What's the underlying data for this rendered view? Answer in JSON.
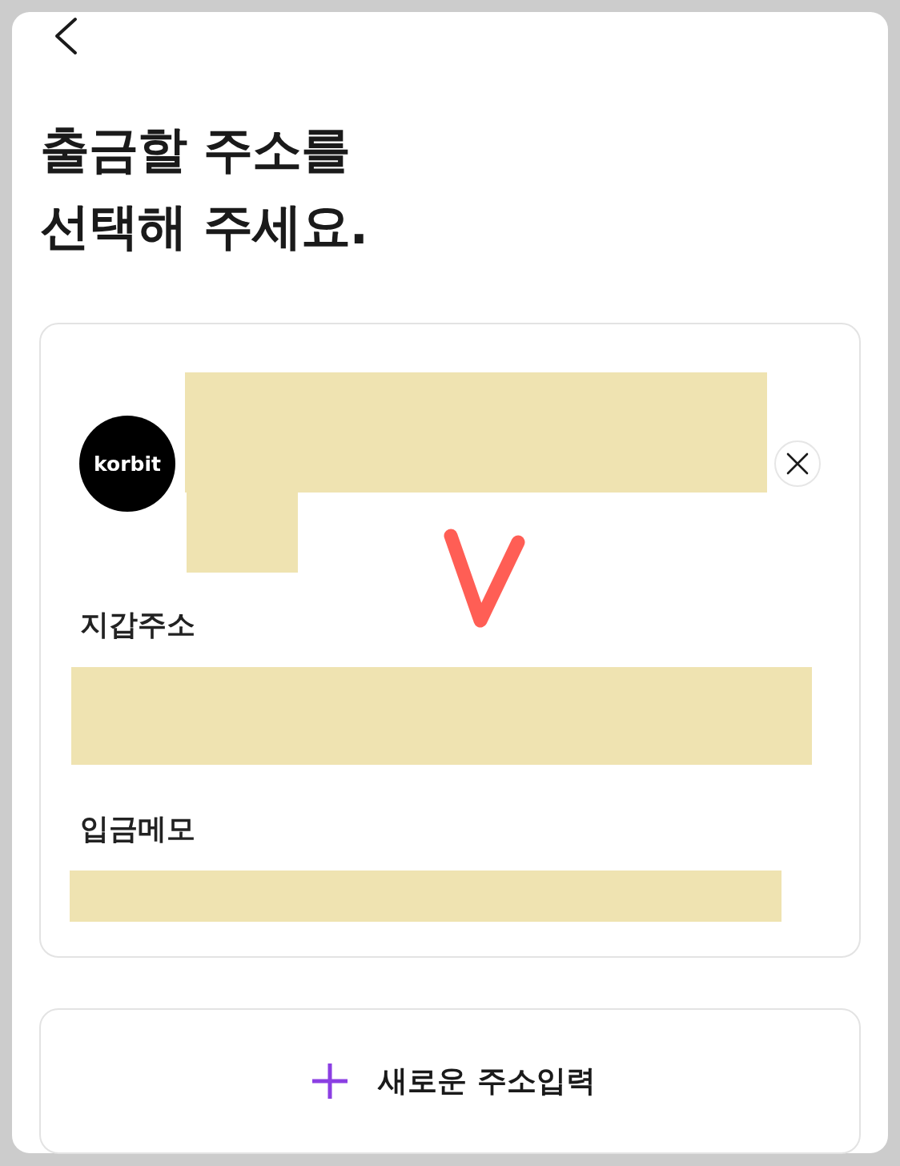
{
  "title": {
    "lines": [
      "출금할 주소를",
      "선택해 주세요."
    ]
  },
  "saved_addresses": [
    {
      "exchange": "korbit",
      "fields": [
        {
          "label": "지갑주소"
        },
        {
          "label": "입금메모"
        }
      ]
    }
  ],
  "add_button": {
    "label": "새로운 주소입력"
  }
}
